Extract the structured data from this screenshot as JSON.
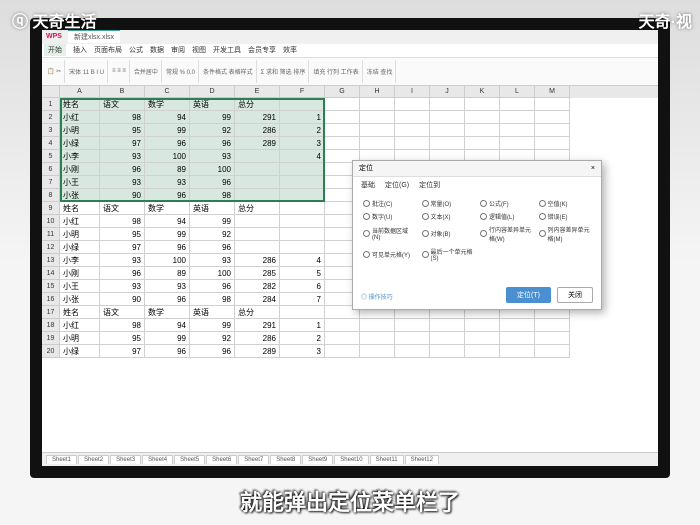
{
  "watermarks": {
    "tl": "ⓠ 天奇生活",
    "tr": "天奇·视"
  },
  "subtitle": "就能弹出定位菜单栏了",
  "titlebar": {
    "app": "WPS",
    "doc": "新建xlsx.xlsx"
  },
  "menu": [
    "开始",
    "插入",
    "页面布局",
    "公式",
    "数据",
    "审阅",
    "视图",
    "开发工具",
    "会员专享",
    "效率"
  ],
  "cols": [
    "A",
    "B",
    "C",
    "D",
    "E",
    "F",
    "G",
    "H",
    "I",
    "J",
    "K",
    "L",
    "M"
  ],
  "headers": [
    "姓名",
    "语文",
    "数学",
    "英语",
    "总分",
    ""
  ],
  "rows": [
    [
      "小红",
      "98",
      "94",
      "99",
      "291",
      "1"
    ],
    [
      "小明",
      "95",
      "99",
      "92",
      "286",
      "2"
    ],
    [
      "小绿",
      "97",
      "96",
      "96",
      "289",
      "3"
    ],
    [
      "小李",
      "93",
      "100",
      "93",
      "",
      "4"
    ],
    [
      "小刚",
      "96",
      "89",
      "100",
      "",
      ""
    ],
    [
      "小王",
      "93",
      "93",
      "96",
      "",
      ""
    ],
    [
      "小张",
      "90",
      "96",
      "98",
      "",
      ""
    ],
    [
      "姓名",
      "语文",
      "数学",
      "英语",
      "总分",
      ""
    ],
    [
      "小红",
      "98",
      "94",
      "99",
      "",
      ""
    ],
    [
      "小明",
      "95",
      "99",
      "92",
      "",
      ""
    ],
    [
      "小绿",
      "97",
      "96",
      "96",
      "",
      ""
    ],
    [
      "小李",
      "93",
      "100",
      "93",
      "286",
      "4"
    ],
    [
      "小刚",
      "96",
      "89",
      "100",
      "285",
      "5"
    ],
    [
      "小王",
      "93",
      "93",
      "96",
      "282",
      "6"
    ],
    [
      "小张",
      "90",
      "96",
      "98",
      "284",
      "7"
    ],
    [
      "姓名",
      "语文",
      "数学",
      "英语",
      "总分",
      ""
    ],
    [
      "小红",
      "98",
      "94",
      "99",
      "291",
      "1"
    ],
    [
      "小明",
      "95",
      "99",
      "92",
      "286",
      "2"
    ],
    [
      "小绿",
      "97",
      "96",
      "96",
      "289",
      "3"
    ]
  ],
  "dialog": {
    "title": "定位",
    "close": "×",
    "tabs": [
      "基础",
      "定位(G)",
      "定位到"
    ],
    "options": [
      "批注(C)",
      "常量(O)",
      "公式(F)",
      "空值(K)",
      "数字(U)",
      "文本(X)",
      "逻辑值(L)",
      "错误(E)",
      "当前数据区域(N)",
      "对象(B)",
      "行内容差异单元格(W)",
      "列内容差异单元格(M)",
      "可见单元格(Y)",
      "最后一个单元格(S)"
    ],
    "link": "◎ 操作技巧",
    "ok": "定位(T)",
    "cancel": "关闭"
  },
  "sheets": [
    "Sheet1",
    "Sheet2",
    "Sheet3",
    "Sheet4",
    "Sheet5",
    "Sheet6",
    "Sheet7",
    "Sheet8",
    "Sheet9",
    "Sheet10",
    "Sheet11",
    "Sheet12"
  ]
}
